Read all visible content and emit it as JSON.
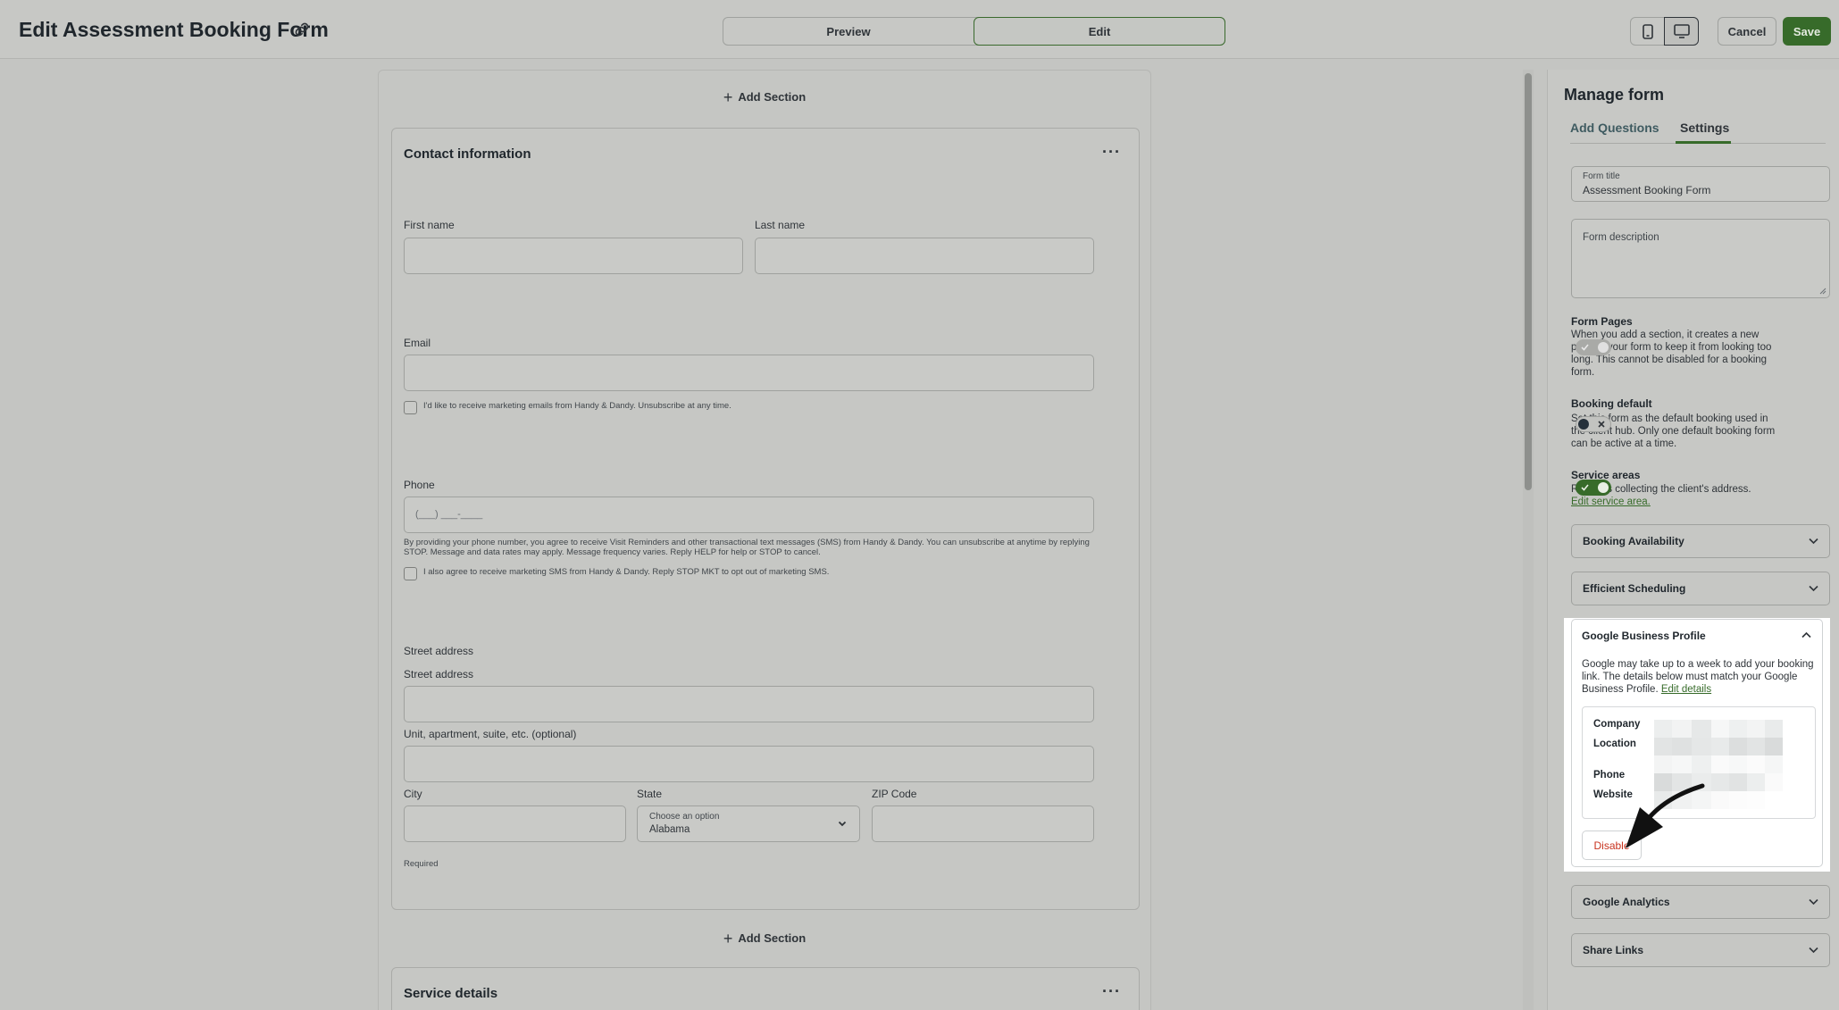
{
  "header": {
    "title": "Edit Assessment Booking Form",
    "tabs": {
      "preview": "Preview",
      "edit": "Edit"
    },
    "cancel": "Cancel",
    "save": "Save"
  },
  "canvas": {
    "add_section": "Add Section",
    "contact_card": {
      "title": "Contact information",
      "more": "···",
      "first_name": "First name",
      "last_name": "Last name",
      "email": "Email",
      "email_optin": "I'd like to receive marketing emails from Handy & Dandy. Unsubscribe at any time.",
      "phone": "Phone",
      "phone_placeholder": "(___) ___-____",
      "phone_disclaimer": "By providing your phone number, you agree to receive Visit Reminders and other transactional text messages (SMS) from Handy & Dandy. You can unsubscribe at anytime by replying STOP. Message and data rates may apply. Message frequency varies. Reply HELP for help or STOP to cancel.",
      "sms_optin": "I also agree to receive marketing SMS from Handy & Dandy. Reply STOP MKT to opt out of marketing SMS.",
      "street_heading": "Street address",
      "street_label": "Street address",
      "unit_label": "Unit, apartment, suite, etc. (optional)",
      "city": "City",
      "state": "State",
      "state_hint": "Choose an option",
      "state_value": "Alabama",
      "zip": "ZIP Code",
      "required": "Required"
    },
    "service_card": {
      "title": "Service details",
      "more": "···"
    }
  },
  "panel": {
    "title": "Manage form",
    "tabs": {
      "add_questions": "Add Questions",
      "settings": "Settings"
    },
    "form_title_label": "Form title",
    "form_title_value": "Assessment Booking Form",
    "form_description_label": "Form description",
    "form_pages": {
      "title": "Form Pages",
      "desc": "When you add a section, it creates a new page in your form to keep it from looking too long. This cannot be disabled for a booking form.",
      "toggle": "on-disabled"
    },
    "booking_default": {
      "title": "Booking default",
      "desc": "Set this form as the default booking used in the client hub. Only one default booking form can be active at a time.",
      "toggle": "off"
    },
    "service_areas": {
      "title": "Service areas",
      "desc": "Requires collecting the client's address.",
      "link": "Edit service area.",
      "toggle": "on"
    },
    "accordions": {
      "availability": "Booking Availability",
      "scheduling": "Efficient Scheduling",
      "analytics": "Google Analytics",
      "share": "Share Links"
    },
    "gbp": {
      "title": "Google Business Profile",
      "desc": "Google may take up to a week to add your booking link. The details below must match your Google Business Profile.",
      "link": "Edit details",
      "keys": {
        "company": "Company",
        "location": "Location",
        "phone": "Phone",
        "website": "Website"
      },
      "disable": "Disable"
    }
  },
  "colors": {
    "accent": "#376b2a",
    "danger": "#c8331f",
    "background": "#c4c5c2"
  }
}
